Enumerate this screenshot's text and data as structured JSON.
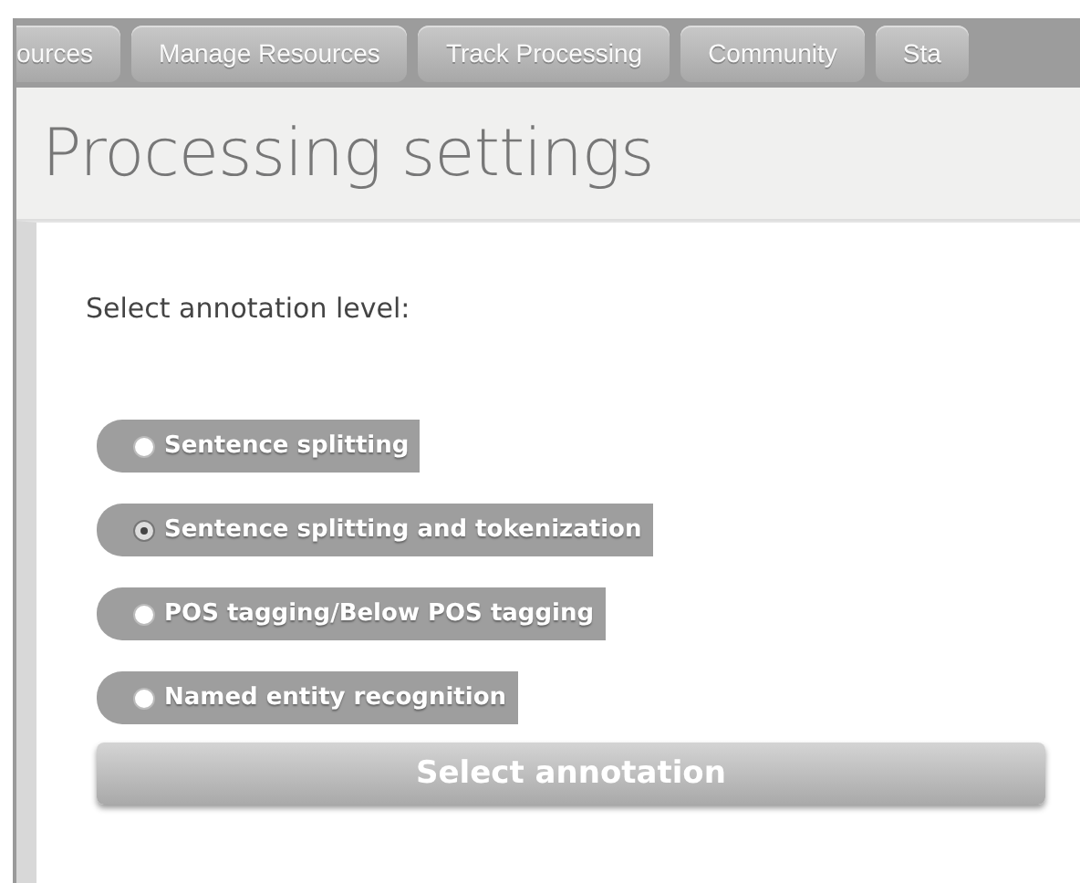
{
  "nav": {
    "tabs": [
      {
        "label": "ources",
        "selected": false
      },
      {
        "label": "Manage Resources",
        "selected": false
      },
      {
        "label": "Track Processing",
        "selected": false
      },
      {
        "label": "Community",
        "selected": false
      },
      {
        "label": "Sta",
        "selected": false
      }
    ]
  },
  "page": {
    "title": "Processing settings"
  },
  "form": {
    "prompt": "Select annotation level:",
    "options": [
      {
        "label": "Sentence splitting",
        "selected": false
      },
      {
        "label": "Sentence splitting and tokenization",
        "selected": true
      },
      {
        "label": "POS tagging/Below POS tagging",
        "selected": false
      },
      {
        "label": "Named entity recognition",
        "selected": false
      }
    ],
    "submit": "Select annotation"
  }
}
